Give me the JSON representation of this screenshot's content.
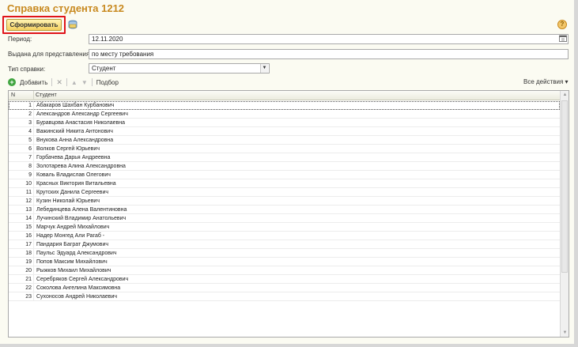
{
  "window": {
    "title": "Справка студента 1212"
  },
  "toolbar_top": {
    "form_button_label": "Сформировать",
    "help_icon": "question-circle-icon",
    "help_glyph": "?"
  },
  "form": {
    "period_label": "Период:",
    "period_value": "12.11.2020",
    "issued_label": "Выдана для представления:",
    "issued_value": "по месту требования",
    "type_label": "Тип справки:",
    "type_value": "Студент"
  },
  "table_toolbar": {
    "add_label": "Добавить",
    "select_label": "Подбор",
    "all_actions_label": "Все действия ▾"
  },
  "table": {
    "columns": [
      "N",
      "Студент"
    ],
    "rows": [
      {
        "n": "1",
        "student": "Абакаров Шахбан Курбанович"
      },
      {
        "n": "2",
        "student": "Александров Александр Сергеевич"
      },
      {
        "n": "3",
        "student": "Буравцова Анастасия Николаевна"
      },
      {
        "n": "4",
        "student": "Важинский Никита Антонович"
      },
      {
        "n": "5",
        "student": "Внукова Анна Александровна"
      },
      {
        "n": "6",
        "student": "Волков Сергей Юрьевич"
      },
      {
        "n": "7",
        "student": "Горбачева Дарья Андреевна"
      },
      {
        "n": "8",
        "student": "Золотарева Алина Александровна"
      },
      {
        "n": "9",
        "student": "Коваль Владислав Олегович"
      },
      {
        "n": "10",
        "student": "Красных Виктория Витальевна"
      },
      {
        "n": "11",
        "student": "Крутских Данила Сергеевич"
      },
      {
        "n": "12",
        "student": "Кузин Николай Юрьевич"
      },
      {
        "n": "13",
        "student": "Лебединцева Алена Валентиновна"
      },
      {
        "n": "14",
        "student": "Лучинский Владимир Анатольевич"
      },
      {
        "n": "15",
        "student": "Марчук Андрей Михайлович"
      },
      {
        "n": "16",
        "student": "Надер Монгед Али Рагаб -"
      },
      {
        "n": "17",
        "student": "Пандария Баграт Джумович"
      },
      {
        "n": "18",
        "student": "Паульс Эдуард Александрович"
      },
      {
        "n": "19",
        "student": "Попов Максим Михайлович"
      },
      {
        "n": "20",
        "student": "Рыжков Михаил Михайлович"
      },
      {
        "n": "21",
        "student": "Серебряков Сергей Александрович"
      },
      {
        "n": "22",
        "student": "Соколова Ангелина Максимовна"
      },
      {
        "n": "23",
        "student": "Сухоносов Андрей Николаевич"
      }
    ]
  }
}
